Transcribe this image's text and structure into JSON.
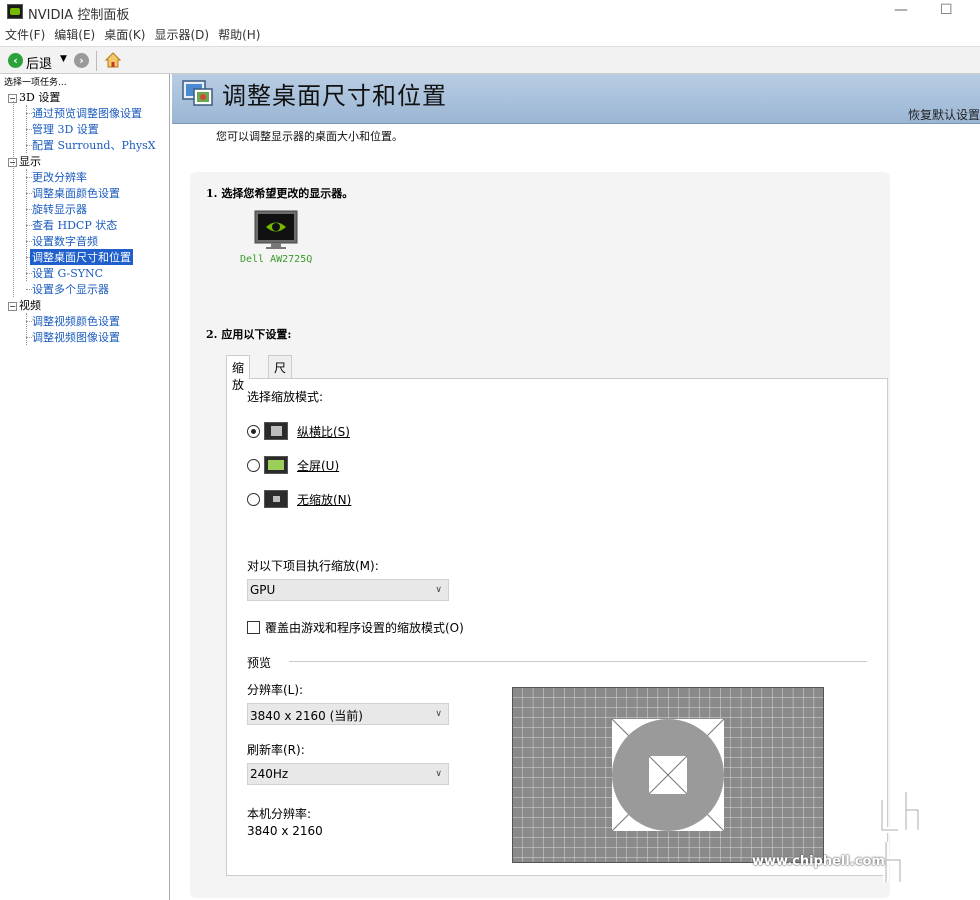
{
  "window": {
    "title": "NVIDIA 控制面板"
  },
  "menu": [
    "文件(F)",
    "编辑(E)",
    "桌面(K)",
    "显示器(D)",
    "帮助(H)"
  ],
  "toolbar": {
    "back_label": "后退"
  },
  "sidebar": {
    "header": "选择一项任务...",
    "categories": [
      {
        "label": "3D 设置",
        "items": [
          "通过预览调整图像设置",
          "管理 3D 设置",
          "配置 Surround、PhysX"
        ]
      },
      {
        "label": "显示",
        "items": [
          "更改分辨率",
          "调整桌面颜色设置",
          "旋转显示器",
          "查看 HDCP 状态",
          "设置数字音频",
          "调整桌面尺寸和位置",
          "设置 G-SYNC",
          "设置多个显示器"
        ]
      },
      {
        "label": "视频",
        "items": [
          "调整视频颜色设置",
          "调整视频图像设置"
        ]
      }
    ],
    "selected": "调整桌面尺寸和位置"
  },
  "page": {
    "title": "调整桌面尺寸和位置",
    "restore_defaults": "恢复默认设置",
    "description": "您可以调整显示器的桌面大小和位置。",
    "step1": "1. 选择您希望更改的显示器。",
    "monitor_name": "Dell AW2725Q",
    "step2": "2. 应用以下设置:",
    "tabs": [
      "缩放",
      "尺寸"
    ],
    "scaling_mode_title": "选择缩放模式:",
    "modes": [
      {
        "label": "纵横比(S)",
        "checked": true
      },
      {
        "label": "全屏(U)",
        "checked": false
      },
      {
        "label": "无缩放(N)",
        "checked": false
      }
    ],
    "perform_scaling_label": "对以下项目执行缩放(M):",
    "perform_scaling_value": "GPU",
    "override_label": "覆盖由游戏和程序设置的缩放模式(O)",
    "override_checked": false,
    "preview_label": "预览",
    "resolution_label": "分辨率(L):",
    "resolution_value": "3840 x 2160 (当前)",
    "refresh_label": "刷新率(R):",
    "refresh_value": "240Hz",
    "native_label": "本机分辨率:",
    "native_value": "3840 x 2160"
  },
  "watermark": {
    "url": "www.chiphell.com"
  },
  "colors": {
    "banner": "#a9c1dc",
    "link": "#1a5bbd",
    "nvidia_green": "#76b900",
    "selected": "#1e5fcc"
  }
}
